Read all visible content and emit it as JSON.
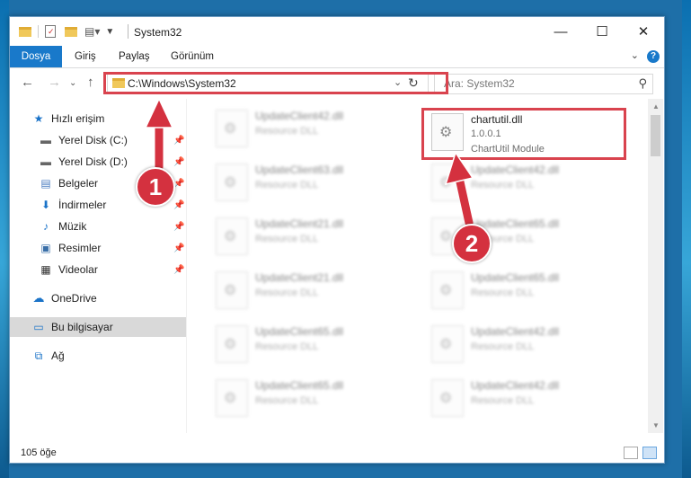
{
  "window": {
    "title": "System32",
    "controls": {
      "minimize": "—",
      "maximize": "☐",
      "close": "✕"
    }
  },
  "ribbon": {
    "tabs": [
      "Dosya",
      "Giriş",
      "Paylaş",
      "Görünüm"
    ],
    "help": "?"
  },
  "nav": {
    "address": "C:\\Windows\\System32",
    "search_placeholder": "Ara: System32"
  },
  "sidebar": {
    "items": [
      {
        "label": "Hızlı erişim",
        "icon": "star-icon"
      },
      {
        "label": "Yerel Disk (C:)",
        "icon": "drive-icon"
      },
      {
        "label": "Yerel Disk (D:)",
        "icon": "drive-icon"
      },
      {
        "label": "Belgeler",
        "icon": "document-icon"
      },
      {
        "label": "İndirmeler",
        "icon": "download-icon"
      },
      {
        "label": "Müzik",
        "icon": "music-icon"
      },
      {
        "label": "Resimler",
        "icon": "pictures-icon"
      },
      {
        "label": "Videolar",
        "icon": "video-icon"
      },
      {
        "label": "OneDrive",
        "icon": "cloud-icon"
      },
      {
        "label": "Bu bilgisayar",
        "icon": "computer-icon"
      },
      {
        "label": "Ağ",
        "icon": "network-icon"
      }
    ]
  },
  "files": {
    "left": [
      {
        "name": "UpdateClient42.dll",
        "type": "Resource DLL"
      },
      {
        "name": "UpdateClient63.dll",
        "type": "Resource DLL"
      },
      {
        "name": "UpdateClient21.dll",
        "type": "Resource DLL"
      },
      {
        "name": "UpdateClient21.dll",
        "type": "Resource DLL"
      },
      {
        "name": "UpdateClient65.dll",
        "type": "Resource DLL"
      },
      {
        "name": "UpdateClient65.dll",
        "type": "Resource DLL"
      }
    ],
    "right": [
      {
        "name": "chartutil.dll",
        "version": "1.0.0.1",
        "type": "ChartUtil Module"
      },
      {
        "name": "UpdateClient42.dll",
        "type": "Resource DLL"
      },
      {
        "name": "UpdateClient65.dll",
        "type": "Resource DLL"
      },
      {
        "name": "UpdateClient65.dll",
        "type": "Resource DLL"
      },
      {
        "name": "UpdateClient42.dll",
        "type": "Resource DLL"
      },
      {
        "name": "UpdateClient42.dll",
        "type": "Resource DLL"
      }
    ]
  },
  "status": {
    "count": "105 öğe"
  },
  "annotations": {
    "step1": "1",
    "step2": "2",
    "color": "#d4313f"
  }
}
